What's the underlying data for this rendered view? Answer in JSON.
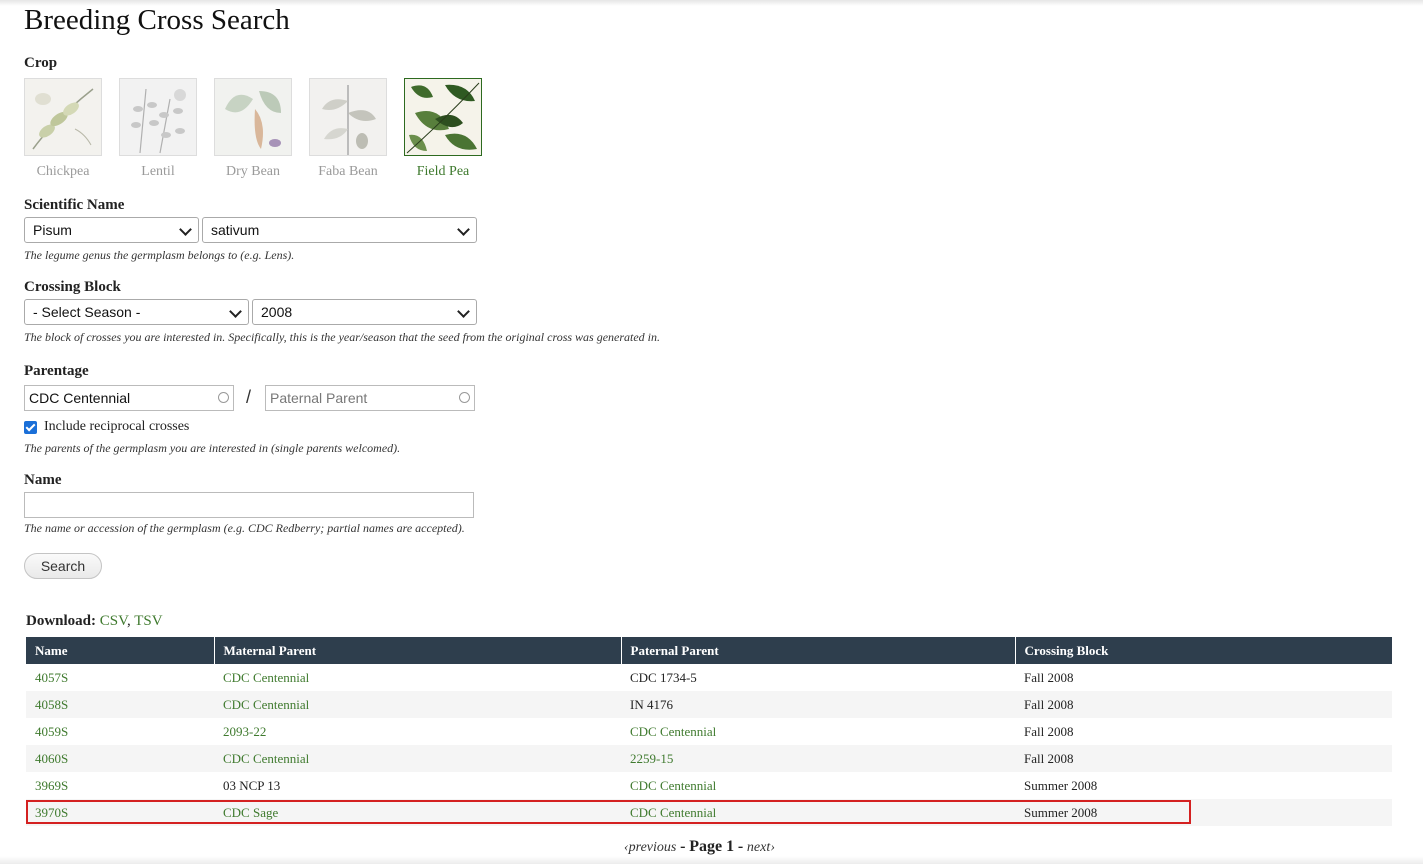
{
  "page": {
    "title": "Breeding Cross Search"
  },
  "crop": {
    "label": "Crop",
    "options": [
      {
        "name": "Chickpea",
        "active": false
      },
      {
        "name": "Lentil",
        "active": false
      },
      {
        "name": "Dry Bean",
        "active": false
      },
      {
        "name": "Faba Bean",
        "active": false
      },
      {
        "name": "Field Pea",
        "active": true
      }
    ]
  },
  "scientific_name": {
    "label": "Scientific Name",
    "genus": "Pisum",
    "species": "sativum",
    "description": "The legume genus the germplasm belongs to (e.g. Lens)."
  },
  "crossing_block": {
    "label": "Crossing Block",
    "season": "- Select Season -",
    "year": "2008",
    "description": "The block of crosses you are interested in. Specifically, this is the year/season that the seed from the original cross was generated in."
  },
  "parentage": {
    "label": "Parentage",
    "maternal_value": "CDC Centennial",
    "paternal_placeholder": "Paternal Parent",
    "separator": "/",
    "reciprocal_label": "Include reciprocal crosses",
    "reciprocal_checked": true,
    "description": "The parents of the germplasm you are interested in (single parents welcomed)."
  },
  "name_field": {
    "label": "Name",
    "value": "",
    "description": "The name or accession of the germplasm (e.g. CDC Redberry; partial names are accepted)."
  },
  "search_button": "Search",
  "download": {
    "label": "Download:",
    "csv": "CSV",
    "separator": ",",
    "tsv": "TSV"
  },
  "table": {
    "columns": [
      "Name",
      "Maternal Parent",
      "Paternal Parent",
      "Crossing Block"
    ],
    "rows": [
      {
        "name": "4057S",
        "maternal": "CDC Centennial",
        "maternal_link": true,
        "paternal": "CDC 1734-5",
        "paternal_link": false,
        "block": "Fall 2008"
      },
      {
        "name": "4058S",
        "maternal": "CDC Centennial",
        "maternal_link": true,
        "paternal": "IN 4176",
        "paternal_link": false,
        "block": "Fall 2008"
      },
      {
        "name": "4059S",
        "maternal": "2093-22",
        "maternal_link": true,
        "paternal": "CDC Centennial",
        "paternal_link": true,
        "block": "Fall 2008"
      },
      {
        "name": "4060S",
        "maternal": "CDC Centennial",
        "maternal_link": true,
        "paternal": "2259-15",
        "paternal_link": true,
        "block": "Fall 2008"
      },
      {
        "name": "3969S",
        "maternal": "03 NCP 13",
        "maternal_link": false,
        "paternal": "CDC Centennial",
        "paternal_link": true,
        "block": "Summer 2008"
      },
      {
        "name": "3970S",
        "maternal": "CDC Sage",
        "maternal_link": true,
        "paternal": "CDC Centennial",
        "paternal_link": true,
        "block": "Summer 2008"
      }
    ],
    "highlighted_row": "3970S"
  },
  "pager": {
    "previous": "‹previous",
    "dash": "-",
    "page": "Page 1",
    "next": "next›"
  },
  "colors": {
    "link": "#3f7a2e",
    "header_bg": "#2e3e4d",
    "highlight": "#d42121",
    "checkbox": "#1a6fd8"
  }
}
